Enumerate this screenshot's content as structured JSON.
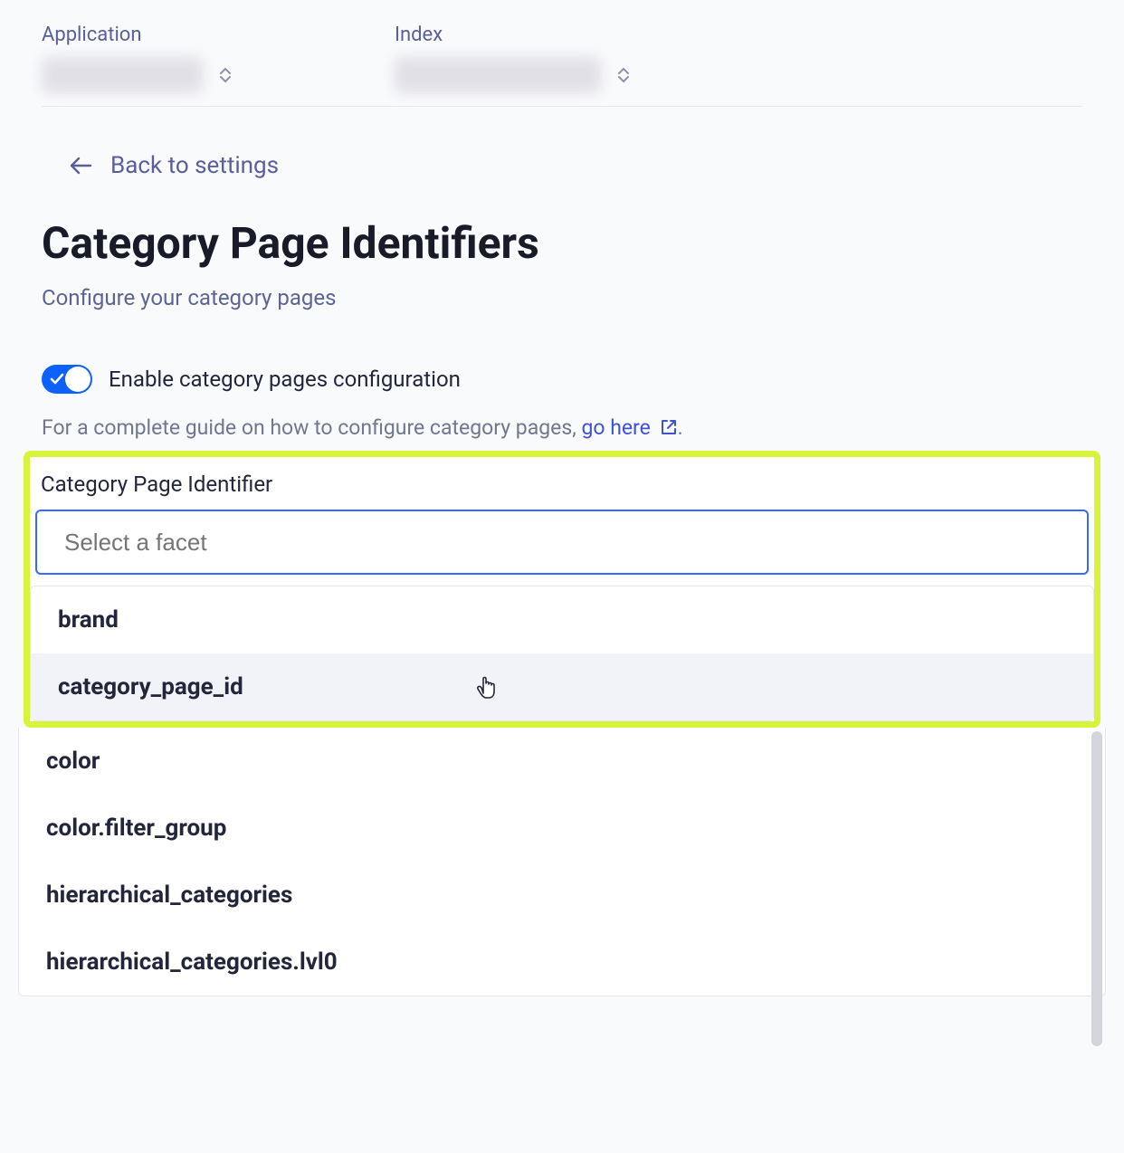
{
  "topbar": {
    "application_label": "Application",
    "index_label": "Index"
  },
  "back_link": "Back to settings",
  "page_title": "Category Page Identifiers",
  "subtitle": "Configure your category pages",
  "toggle_label": "Enable category pages configuration",
  "help_text_prefix": "For a complete guide on how to configure category pages, ",
  "help_link": "go here",
  "section_label": "Category Page Identifier",
  "facet_placeholder": "Select a facet",
  "options": [
    "brand",
    "category_page_id",
    "color",
    "color.filter_group",
    "hierarchical_categories",
    "hierarchical_categories.lvl0"
  ]
}
